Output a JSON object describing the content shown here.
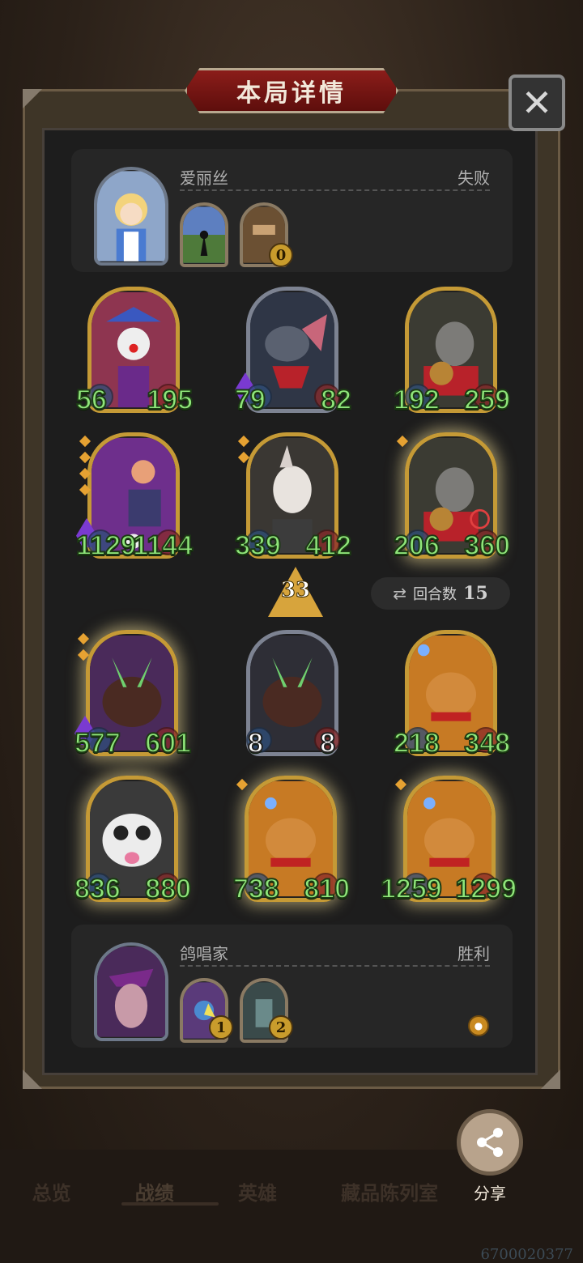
{
  "title": "本局详情",
  "close_label": "✕",
  "top_player": {
    "name": "爱丽丝",
    "result": "失败",
    "items": [
      {
        "badge": ""
      },
      {
        "badge": "0"
      }
    ]
  },
  "bottom_player": {
    "name": "鸽唱家",
    "result": "胜利",
    "items": [
      {
        "badge": "1"
      },
      {
        "badge": "2"
      }
    ]
  },
  "enemy_units": [
    {
      "atk": "56",
      "hp": "195"
    },
    {
      "atk": "79",
      "hp": "82"
    },
    {
      "atk": "192",
      "hp": "259"
    },
    {
      "atk": "1129",
      "hp": "1144"
    },
    {
      "atk": "339",
      "hp": "412"
    },
    {
      "atk": "206",
      "hp": "360"
    }
  ],
  "ally_units": [
    {
      "atk": "577",
      "hp": "601"
    },
    {
      "atk": "8",
      "hp": "8"
    },
    {
      "atk": "218",
      "hp": "348"
    },
    {
      "atk": "836",
      "hp": "880"
    },
    {
      "atk": "738",
      "hp": "810"
    },
    {
      "atk": "1259",
      "hp": "1299"
    }
  ],
  "level": "33",
  "round_label": "回合数",
  "round_value": "15",
  "share_label": "分享",
  "nav": [
    "总览",
    "战绩",
    "英雄",
    "藏品陈列室"
  ],
  "footer_id": "6700020377"
}
